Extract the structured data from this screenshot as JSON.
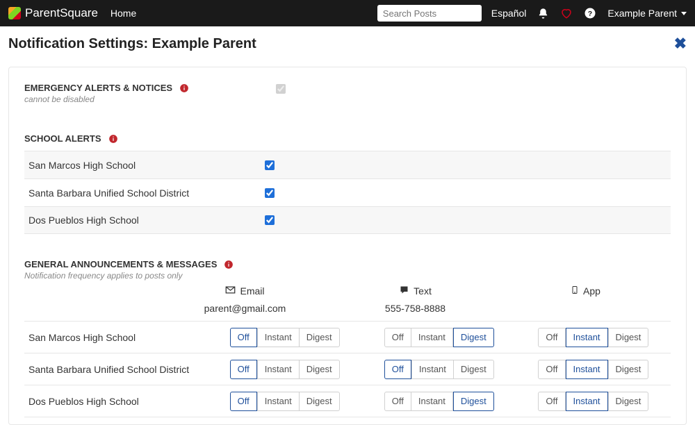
{
  "nav": {
    "brand": "ParentSquare",
    "home": "Home",
    "search_placeholder": "Search Posts",
    "language": "Español",
    "username": "Example Parent"
  },
  "title": "Notification Settings: Example Parent",
  "emergency": {
    "heading": "EMERGENCY ALERTS & NOTICES",
    "sub": "cannot be disabled"
  },
  "school_alerts": {
    "heading": "SCHOOL ALERTS",
    "schools": [
      {
        "name": "San Marcos High School",
        "checked": true
      },
      {
        "name": "Santa Barbara Unified School District",
        "checked": true
      },
      {
        "name": "Dos Pueblos High School",
        "checked": true
      }
    ]
  },
  "general": {
    "heading": "GENERAL ANNOUNCEMENTS & MESSAGES",
    "sub": "Notification frequency applies to posts only",
    "channels": [
      {
        "label": "Email",
        "value": "parent@gmail.com"
      },
      {
        "label": "Text",
        "value": "555-758-8888"
      },
      {
        "label": "App",
        "value": ""
      }
    ],
    "options": [
      "Off",
      "Instant",
      "Digest"
    ],
    "rows": [
      {
        "school": "San Marcos High School",
        "selected": [
          "Off",
          "Digest",
          "Instant"
        ]
      },
      {
        "school": "Santa Barbara Unified School District",
        "selected": [
          "Off",
          "Off",
          "Instant"
        ]
      },
      {
        "school": "Dos Pueblos High School",
        "selected": [
          "Off",
          "Digest",
          "Instant"
        ]
      }
    ]
  }
}
